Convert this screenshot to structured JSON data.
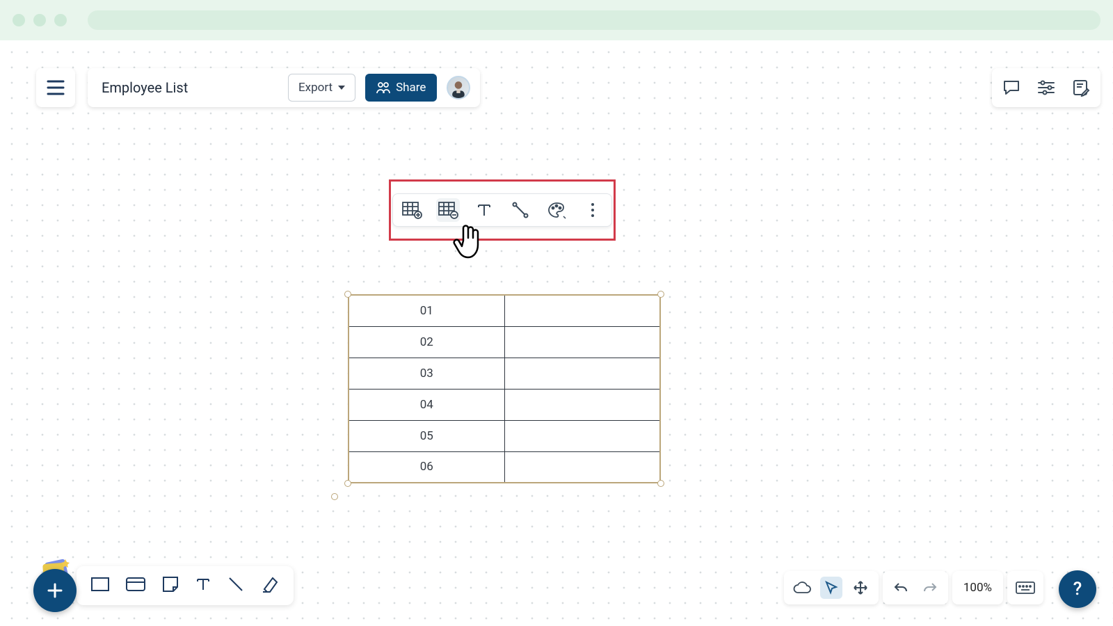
{
  "header": {
    "document_title": "Employee List",
    "export_label": "Export",
    "share_label": "Share"
  },
  "floating_toolbar": {
    "tools": [
      "table-add",
      "table-remove",
      "text",
      "connector",
      "color",
      "more"
    ]
  },
  "table": {
    "rows": [
      {
        "c1": "01",
        "c2": ""
      },
      {
        "c1": "02",
        "c2": ""
      },
      {
        "c1": "03",
        "c2": ""
      },
      {
        "c1": "04",
        "c2": ""
      },
      {
        "c1": "05",
        "c2": ""
      },
      {
        "c1": "06",
        "c2": ""
      }
    ]
  },
  "status": {
    "zoom": "100%",
    "help": "?"
  },
  "colors": {
    "primary": "#0d4a7a",
    "highlight": "#d23b4a",
    "table_border": "#bba67a"
  }
}
